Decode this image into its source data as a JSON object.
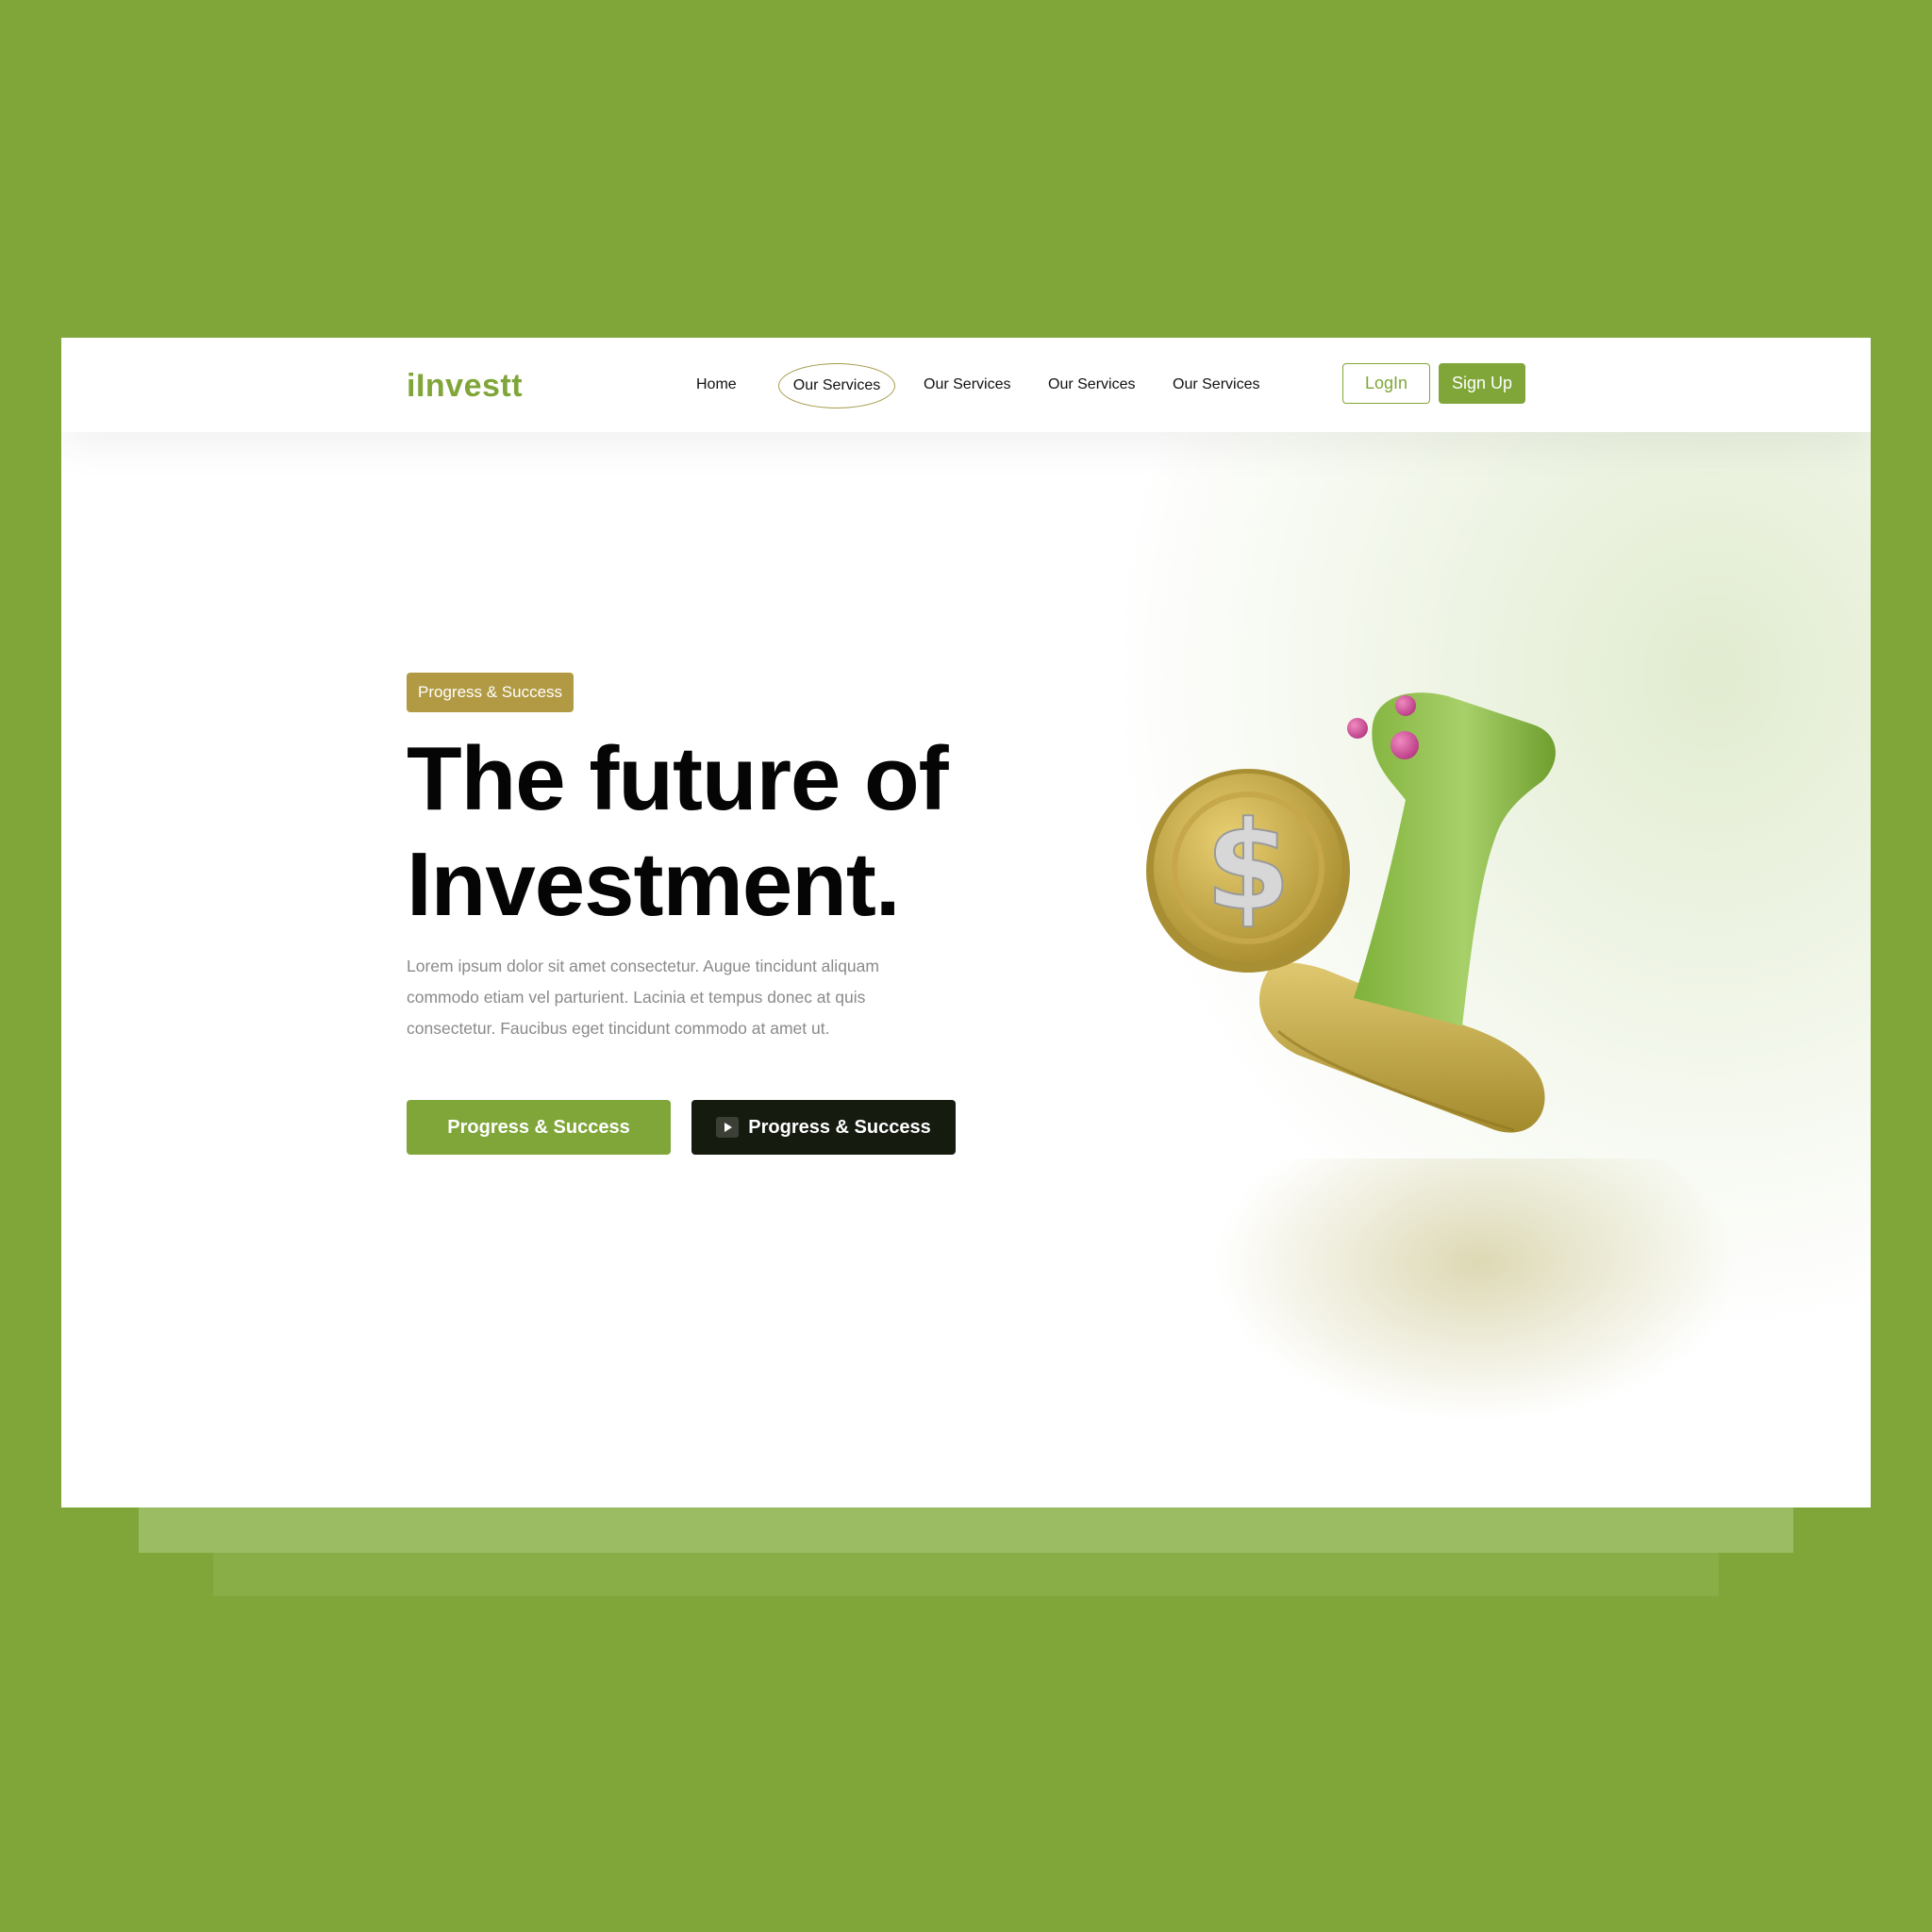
{
  "brand": {
    "logo_text": "iInvestt",
    "accent": "#80a63a",
    "gold": "#b29a44",
    "background": "#80a63a"
  },
  "nav": {
    "links": [
      "Home",
      "Our Services",
      "Our Services",
      "Our Services",
      "Our Services"
    ],
    "active_index": 1,
    "login_label": "LogIn",
    "signup_label": "Sign Up"
  },
  "hero": {
    "tag": "Progress & Success",
    "headline_line1": "The future of",
    "headline_line2": "Investment.",
    "body": "Lorem ipsum dolor sit amet consectetur. Augue tincidunt aliquam commodo etiam vel parturient. Lacinia et tempus donec at quis consectetur. Faucibus eget tincidunt commodo at amet ut.",
    "cta_primary": "Progress & Success",
    "cta_secondary": "Progress & Success",
    "cta_secondary_icon": "play-icon",
    "illustration_icon": "stamp-with-dollar-coin-illustration"
  }
}
